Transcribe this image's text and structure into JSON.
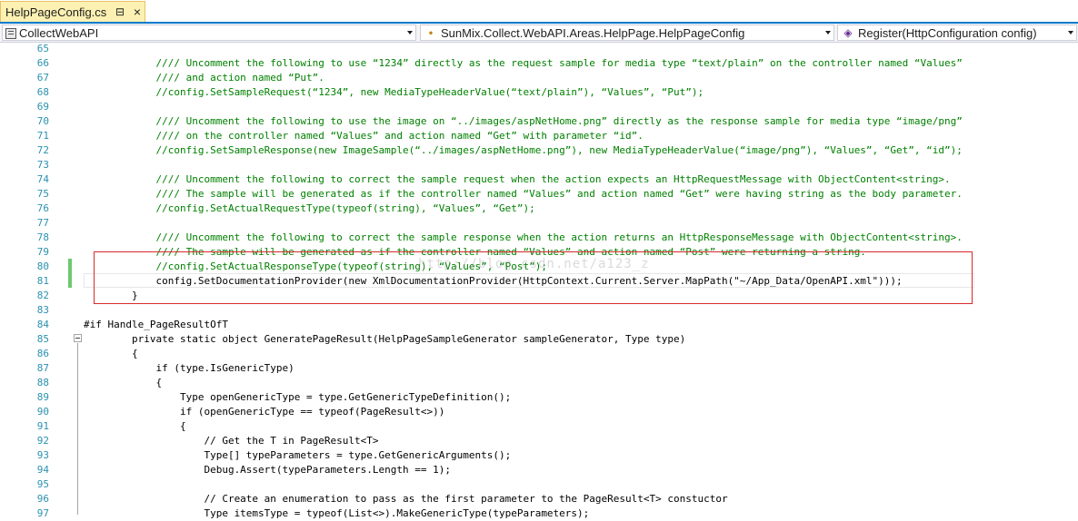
{
  "tab": {
    "label": "HelpPageConfig.cs",
    "pin_glyph": "⊟",
    "close_glyph": "×"
  },
  "navbar": {
    "project": "CollectWebAPI",
    "class": "SunMix.Collect.WebAPI.Areas.HelpPage.HelpPageConfig",
    "member": "Register(HttpConfiguration config)"
  },
  "icons": {
    "class_glyph": "⬩",
    "method_glyph": "◈"
  },
  "watermark": "http://blog.csdn.net/a123_z",
  "colors": {
    "comment": "#008000",
    "line_number": "#2b91af",
    "highlight_border": "#d82a2a",
    "tab_background": "#fcf1b2",
    "accent": "#007acc",
    "change_bar": "#6dc86d"
  },
  "lines": [
    {
      "num": "65",
      "text": "",
      "kind": "plain"
    },
    {
      "num": "66",
      "text": "            //// Uncomment the following to use “1234” directly as the request sample for media type “text/plain” on the controller named “Values”",
      "kind": "comment"
    },
    {
      "num": "67",
      "text": "            //// and action named “Put”.",
      "kind": "comment"
    },
    {
      "num": "68",
      "text": "            //config.SetSampleRequest(“1234”, new MediaTypeHeaderValue(“text/plain”), “Values”, “Put”);",
      "kind": "comment"
    },
    {
      "num": "69",
      "text": "",
      "kind": "plain"
    },
    {
      "num": "70",
      "text": "            //// Uncomment the following to use the image on “../images/aspNetHome.png” directly as the response sample for media type “image/png”",
      "kind": "comment"
    },
    {
      "num": "71",
      "text": "            //// on the controller named “Values” and action named “Get” with parameter “id”.",
      "kind": "comment"
    },
    {
      "num": "72",
      "text": "            //config.SetSampleResponse(new ImageSample(“../images/aspNetHome.png”), new MediaTypeHeaderValue(“image/png”), “Values”, “Get”, “id”);",
      "kind": "comment"
    },
    {
      "num": "73",
      "text": "",
      "kind": "plain"
    },
    {
      "num": "74",
      "text": "            //// Uncomment the following to correct the sample request when the action expects an HttpRequestMessage with ObjectContent<string>.",
      "kind": "comment"
    },
    {
      "num": "75",
      "text": "            //// The sample will be generated as if the controller named “Values” and action named “Get” were having string as the body parameter.",
      "kind": "comment"
    },
    {
      "num": "76",
      "text": "            //config.SetActualRequestType(typeof(string), “Values”, “Get”);",
      "kind": "comment"
    },
    {
      "num": "77",
      "text": "",
      "kind": "plain"
    },
    {
      "num": "78",
      "text": "            //// Uncomment the following to correct the sample response when the action returns an HttpResponseMessage with ObjectContent<string>.",
      "kind": "comment"
    },
    {
      "num": "79",
      "text": "            //// The sample will be generated as if the controller named “Values” and action named “Post” were returning a string.",
      "kind": "comment"
    },
    {
      "num": "80",
      "text": "            //config.SetActualResponseType(typeof(string), “Values”, “Post”);",
      "kind": "comment"
    },
    {
      "num": "81",
      "text": "            config.SetDocumentationProvider(new XmlDocumentationProvider(HttpContext.Current.Server.MapPath(\"~/App_Data/OpenAPI.xml\")));",
      "kind": "plain"
    },
    {
      "num": "82",
      "text": "        }",
      "kind": "plain"
    },
    {
      "num": "83",
      "text": "",
      "kind": "plain"
    },
    {
      "num": "84",
      "text": "#if Handle_PageResultOfT",
      "kind": "directive"
    },
    {
      "num": "85",
      "text": "        private static object GeneratePageResult(HelpPageSampleGenerator sampleGenerator, Type type)",
      "kind": "plain"
    },
    {
      "num": "86",
      "text": "        {",
      "kind": "plain"
    },
    {
      "num": "87",
      "text": "            if (type.IsGenericType)",
      "kind": "plain"
    },
    {
      "num": "88",
      "text": "            {",
      "kind": "plain"
    },
    {
      "num": "89",
      "text": "                Type openGenericType = type.GetGenericTypeDefinition();",
      "kind": "plain"
    },
    {
      "num": "90",
      "text": "                if (openGenericType == typeof(PageResult<>))",
      "kind": "plain"
    },
    {
      "num": "91",
      "text": "                {",
      "kind": "plain"
    },
    {
      "num": "92",
      "text": "                    // Get the T in PageResult<T>",
      "kind": "plain"
    },
    {
      "num": "93",
      "text": "                    Type[] typeParameters = type.GetGenericArguments();",
      "kind": "plain"
    },
    {
      "num": "94",
      "text": "                    Debug.Assert(typeParameters.Length == 1);",
      "kind": "plain"
    },
    {
      "num": "95",
      "text": "",
      "kind": "plain"
    },
    {
      "num": "96",
      "text": "                    // Create an enumeration to pass as the first parameter to the PageResult<T> constuctor",
      "kind": "plain"
    },
    {
      "num": "97",
      "text": "                    Type itemsType = typeof(List<>).MakeGenericType(typeParameters);",
      "kind": "plain"
    }
  ]
}
